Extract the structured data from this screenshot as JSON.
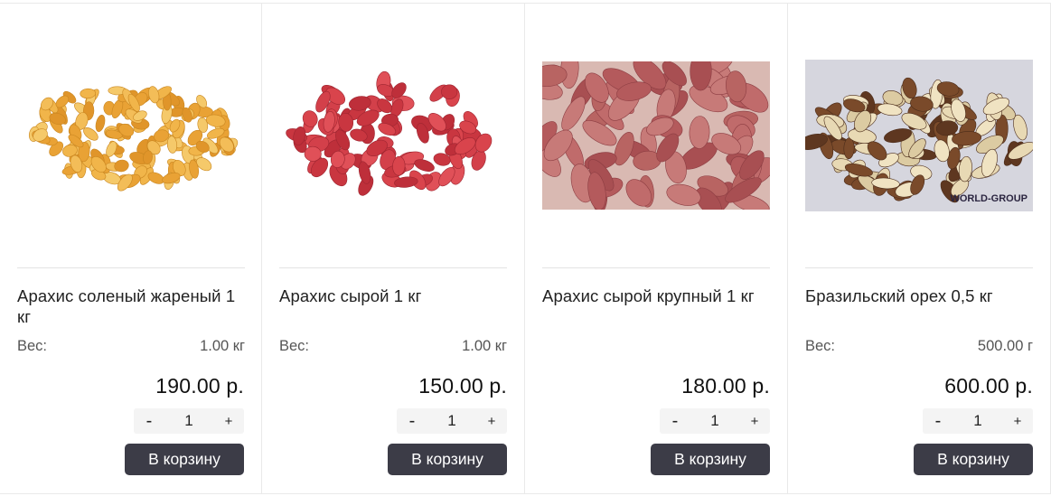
{
  "products": [
    {
      "name": "Арахис соленый жареный 1 кг",
      "weight_label": "Вес:",
      "weight_value": "1.00 кг",
      "price": "190.00 р.",
      "qty": "1",
      "minus": "-",
      "plus": "+",
      "cart_label": "В корзину",
      "image": "salted-roasted-peanuts"
    },
    {
      "name": "Арахис сырой 1 кг",
      "weight_label": "Вес:",
      "weight_value": "1.00 кг",
      "price": "150.00 р.",
      "qty": "1",
      "minus": "-",
      "plus": "+",
      "cart_label": "В корзину",
      "image": "raw-peanuts"
    },
    {
      "name": "Арахис сырой крупный 1 кг",
      "weight_label": "",
      "weight_value": "",
      "price": "180.00 р.",
      "qty": "1",
      "minus": "-",
      "plus": "+",
      "cart_label": "В корзину",
      "image": "large-raw-peanuts"
    },
    {
      "name": "Бразильский орех 0,5 кг",
      "weight_label": "Вес:",
      "weight_value": "500.00 г",
      "price": "600.00 р.",
      "qty": "1",
      "minus": "-",
      "plus": "+",
      "cart_label": "В корзину",
      "image": "brazil-nuts",
      "image_watermark": "WORLD-GROUP"
    }
  ],
  "colors": {
    "button_bg": "#3c3c47",
    "qty_bg": "#f4f4f4",
    "border": "#e9e9e9"
  }
}
